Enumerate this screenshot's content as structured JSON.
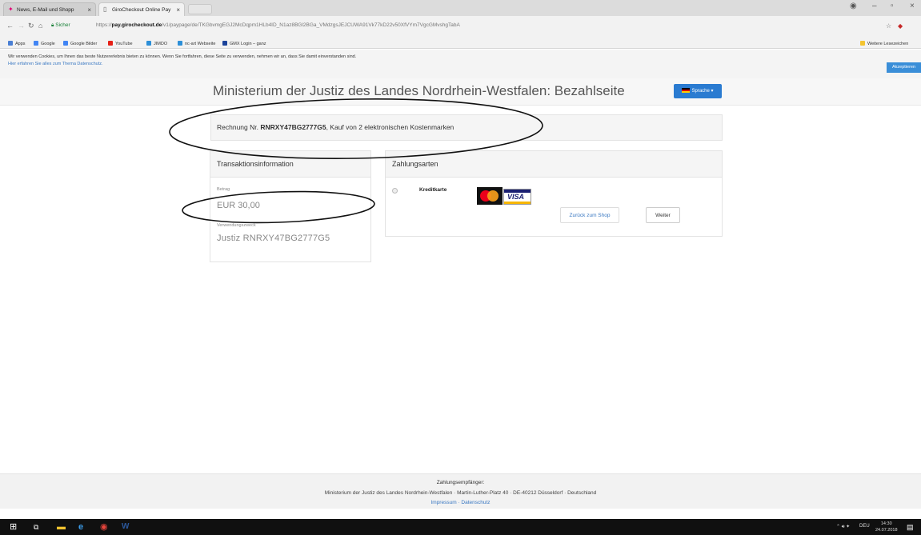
{
  "browser": {
    "tabs": [
      {
        "label": "News, E-Mail und Shopp"
      },
      {
        "label": "GiroCheckout Online Pay"
      }
    ],
    "tab_close": "×",
    "secure_label": "Sicher",
    "url_scheme": "https://",
    "url_host": "pay.girocheckout.de",
    "url_path": "/v1/paypage/de/TKGbvmgEGJ2McDqpm1HLb4ID_N1az8BGl2BGa_VMdzgsJEJCUWA91Vk77kD22v50XfVYm7VgcGMvshgTabA",
    "bookmarks": [
      "Apps",
      "Google",
      "Google Bilder",
      "YouTube",
      "JIMDO",
      "nc-art Webseite",
      "GMX Login – ganz"
    ],
    "other_bookmarks": "Weitere Lesezeichen"
  },
  "cookie": {
    "text": "Wir verwenden Cookies, um Ihnen das beste Nutzererlebnis bieten zu können. Wenn Sie fortfahren, diese Seite zu verwenden, nehmen wir an, dass Sie damit einverstanden sind.",
    "link": "Hier erfahren Sie alles zum Thema Datenschutz.",
    "accept": "Akzeptieren"
  },
  "page": {
    "title": "Ministerium der Justiz des Landes Nordrhein-Westfalen: Bezahlseite",
    "language_button": "Sprache ▾"
  },
  "invoice": {
    "prefix": "Rechnung Nr.",
    "number": "RNRXY47BG2777G5",
    "suffix": ", Kauf von 2 elektronischen Kostenmarken"
  },
  "transaction": {
    "title": "Transaktionsinformation",
    "amount_label": "Betrag",
    "amount": "EUR 30,00",
    "purpose_label": "Verwendungszweck",
    "purpose": "Justiz RNRXY47BG2777G5"
  },
  "payment": {
    "title": "Zahlungsarten",
    "method": "Kreditkarte",
    "visa": "VISA",
    "back": "Zurück zum Shop",
    "next": "Weiter"
  },
  "footer": {
    "title": "Zahlungsempfänger:",
    "address": "Ministerium der Justiz des Landes Nordrhein-Westfalen · Martin-Luther-Platz 40 · DE-40212 Düsseldorf · Deutschland",
    "links": "Impressum · Datenschutz"
  },
  "taskbar": {
    "lang": "DEU",
    "time": "14:30",
    "date": "24.07.2018"
  }
}
